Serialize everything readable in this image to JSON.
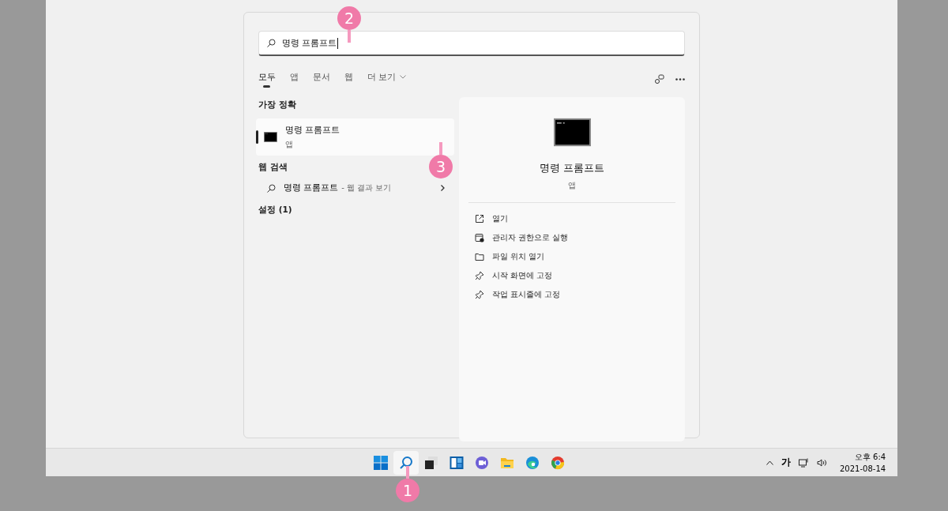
{
  "search": {
    "value": "명령 프롬프트"
  },
  "tabs": [
    {
      "label": "모두",
      "selected": true,
      "kind": "plain"
    },
    {
      "label": "앱",
      "selected": false,
      "kind": "plain"
    },
    {
      "label": "문서",
      "selected": false,
      "kind": "plain"
    },
    {
      "label": "웹",
      "selected": false,
      "kind": "plain"
    },
    {
      "label": "더 보기",
      "selected": false,
      "kind": "dropdown"
    }
  ],
  "best_match": {
    "heading": "가장 정확",
    "title": "명령 프롬프트",
    "subtitle": "앱",
    "selected": true
  },
  "web_search": {
    "heading": "웹 검색",
    "query": "명령 프롬프트",
    "suffix": "- 웹 결과 보기"
  },
  "settings": {
    "heading": "설정 (1)"
  },
  "detail": {
    "title": "명령 프롬프트",
    "subtitle": "앱",
    "actions": [
      {
        "label": "열기",
        "kind": "open"
      },
      {
        "label": "관리자 권한으로 실행",
        "kind": "admin"
      },
      {
        "label": "파일 위치 열기",
        "kind": "folder"
      },
      {
        "label": "시작 화면에 고정",
        "kind": "pin"
      },
      {
        "label": "작업 표시줄에 고정",
        "kind": "pin"
      }
    ]
  },
  "taskbar": {
    "apps": [
      {
        "kind": "start",
        "selected": false
      },
      {
        "kind": "search",
        "selected": true
      },
      {
        "kind": "taskview",
        "selected": false
      },
      {
        "kind": "widgets",
        "selected": false
      },
      {
        "kind": "chat",
        "selected": false
      },
      {
        "kind": "explorer",
        "selected": false
      },
      {
        "kind": "edge",
        "selected": false
      },
      {
        "kind": "chrome",
        "selected": false
      }
    ],
    "ime": "가",
    "time": "오후 6:4",
    "date": "2021-08-14"
  },
  "annotations": [
    {
      "label": "1"
    },
    {
      "label": "2"
    },
    {
      "label": "3"
    }
  ]
}
